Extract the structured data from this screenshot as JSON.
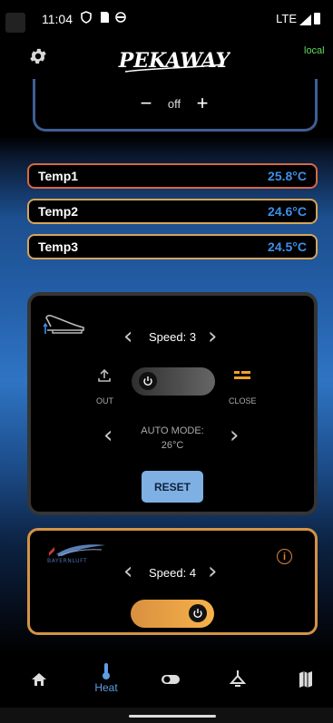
{
  "status_bar": {
    "time": "11:04",
    "network": "LTE"
  },
  "header": {
    "logo_text": "PEKAWAY",
    "connection": "local"
  },
  "top_control": {
    "minus": "−",
    "value": "off",
    "plus": "+"
  },
  "temps": [
    {
      "name": "Temp1",
      "value": "25.8°C"
    },
    {
      "name": "Temp2",
      "value": "24.6°C"
    },
    {
      "name": "Temp3",
      "value": "24.5°C"
    }
  ],
  "roof_vent": {
    "speed": "Speed: 3",
    "out_label": "OUT",
    "close_label": "CLOSE",
    "auto_mode_label": "AUTO MODE:",
    "auto_mode_value": "26°C",
    "reset_label": "RESET",
    "power_state": "off"
  },
  "heater": {
    "brand": "BAYERNLUFT",
    "speed": "Speed: 4",
    "power_state": "on"
  },
  "nav": [
    {
      "icon": "home-icon",
      "label": ""
    },
    {
      "icon": "thermometer-icon",
      "label": "Heat"
    },
    {
      "icon": "toggle-icon",
      "label": ""
    },
    {
      "icon": "lamp-icon",
      "label": ""
    },
    {
      "icon": "map-icon",
      "label": ""
    }
  ],
  "colors": {
    "accent_blue": "#3d8fea",
    "heat_orange": "#e0843a",
    "local_green": "#5fd95f",
    "reset_blue": "#7eb0e4"
  }
}
